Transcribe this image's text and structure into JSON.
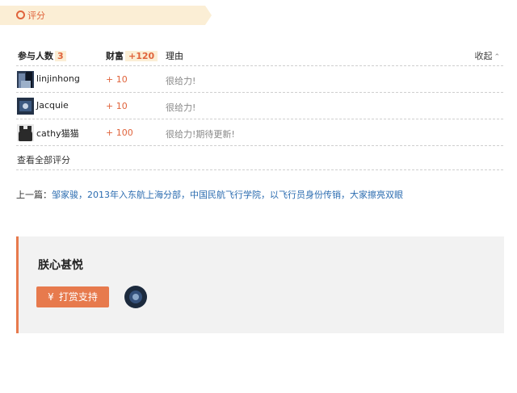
{
  "rating_tab": {
    "title": "评分"
  },
  "rate_header": {
    "participants_label": "参与人数",
    "participants_count": "3",
    "wealth_label": "财富",
    "wealth_total": "+120",
    "reason_label": "理由",
    "collapse_label": "收起"
  },
  "rate_rows": [
    {
      "user": "linjinhong",
      "score": "+ 10",
      "reason": "很给力!"
    },
    {
      "user": "Jacquie",
      "score": "+ 10",
      "reason": "很给力!"
    },
    {
      "user": "cathy猫猫",
      "score": "+ 100",
      "reason": "很给力!期待更新!"
    }
  ],
  "view_all_label": "查看全部评分",
  "prev_post": {
    "label": "上一篇：",
    "title": "邹家骏，2013年入东航上海分部，中国民航飞行学院，以飞行员身份传销，大家擦亮双眼"
  },
  "reward": {
    "title": "朕心甚悦",
    "button_symbol": "¥",
    "button_label": "打赏支持"
  },
  "colors": {
    "accent": "#e0643c",
    "button": "#e77a4d",
    "link": "#2b6cb0",
    "tab_bg": "#fbeed5"
  }
}
